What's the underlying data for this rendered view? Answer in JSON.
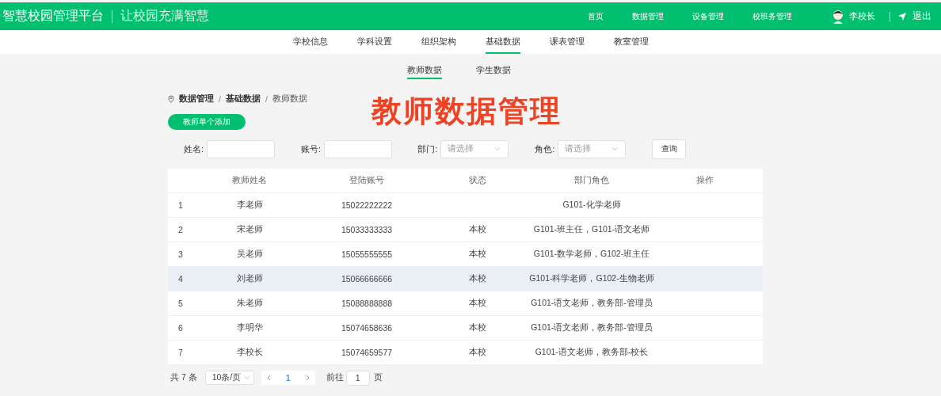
{
  "header": {
    "title": "智慧校园管理平台",
    "slogan": "让校园充满智慧",
    "nav": [
      {
        "label": "首页"
      },
      {
        "label": "数据管理"
      },
      {
        "label": "设备管理"
      },
      {
        "label": "校班务管理"
      }
    ],
    "user": "李校长",
    "logout": "退出"
  },
  "subnav": [
    {
      "label": "学校信息",
      "selected": false
    },
    {
      "label": "学科设置",
      "selected": false
    },
    {
      "label": "组织架构",
      "selected": false
    },
    {
      "label": "基础数据",
      "selected": true
    },
    {
      "label": "课表管理",
      "selected": false
    },
    {
      "label": "教室管理",
      "selected": false
    }
  ],
  "tabs": [
    {
      "label": "教师数据",
      "selected": true
    },
    {
      "label": "学生数据",
      "selected": false
    }
  ],
  "breadcrumb": [
    {
      "kind": "link",
      "label": "数据管理"
    },
    {
      "kind": "separator",
      "label": "/"
    },
    {
      "kind": "link",
      "label": "基础数据"
    },
    {
      "kind": "separator",
      "label": "/"
    },
    {
      "kind": "current",
      "label": "教师数据"
    }
  ],
  "overlay_title": "教师数据管理",
  "add_button": "教师单个添加",
  "filters": [
    {
      "kind": "input",
      "label": "姓名:"
    },
    {
      "kind": "input",
      "label": "账号:"
    },
    {
      "kind": "select",
      "label": "部门:",
      "placeholder": "请选择"
    },
    {
      "kind": "select",
      "label": "角色:",
      "placeholder": "请选择"
    }
  ],
  "search_button": "查询",
  "table": {
    "columns": [
      "教师姓名",
      "登陆账号",
      "状态",
      "部门角色",
      "操作"
    ],
    "rows": [
      {
        "index": "1",
        "name": "李老师",
        "account": "15022222222",
        "role": "G101-化学老师",
        "selected": false
      },
      {
        "index": "2",
        "name": "宋老师",
        "account": "15033333333",
        "status": "本校",
        "role": "G101-班主任，G101-语文老师",
        "selected": false
      },
      {
        "index": "3",
        "name": "吴老师",
        "account": "15055555555",
        "status": "本校",
        "role": "G101-数学老师，G102-班主任",
        "selected": false
      },
      {
        "index": "4",
        "name": "刘老师",
        "account": "15066666666",
        "status": "本校",
        "role": "G101-科学老师，G102-生物老师",
        "selected": true
      },
      {
        "index": "5",
        "name": "朱老师",
        "account": "15088888888",
        "status": "本校",
        "role": "G101-语文老师，教务部-管理员",
        "selected": false
      },
      {
        "index": "6",
        "name": "李明华",
        "account": "15074658636",
        "status": "本校",
        "role": "G101-语文老师，教务部-管理员",
        "selected": false
      },
      {
        "index": "7",
        "name": "李校长",
        "account": "15074659577",
        "status": "本校",
        "role": "G101-语文老师，教务部-校长",
        "selected": false
      }
    ]
  },
  "pagination": {
    "total": "共 7 条",
    "page_size": "10条/页",
    "current_page": "1",
    "goto_label": "前往",
    "goto_value": "1",
    "page_suffix": "页"
  }
}
